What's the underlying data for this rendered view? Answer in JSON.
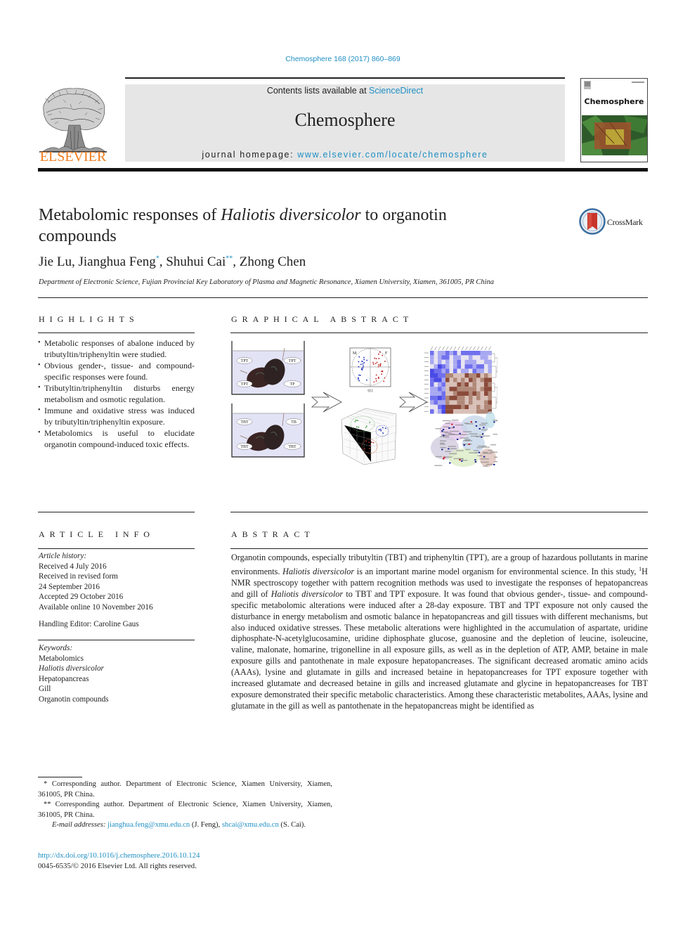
{
  "journal_citation": "Chemosphere 168 (2017) 860–869",
  "header": {
    "publisher_logo_word": "ELSEVIER",
    "contents_prefix": "Contents lists available at ",
    "contents_link": "ScienceDirect",
    "journal_name": "Chemosphere",
    "homepage_prefix": "journal homepage: ",
    "homepage_link": "www.elsevier.com/locate/chemosphere",
    "cover_title": "Chemosphere"
  },
  "article": {
    "title_part1": "Metabolomic responses of ",
    "title_italic": "Haliotis diversicolor",
    "title_part2": " to organotin",
    "title_line2": "compounds",
    "crossmark_label": "CrossMark",
    "authors": [
      {
        "name": "Jie Lu",
        "mark": ""
      },
      {
        "name": "Jianghua Feng",
        "mark": "*"
      },
      {
        "name": "Shuhui Cai",
        "mark": "**"
      },
      {
        "name": "Zhong Chen",
        "mark": ""
      }
    ],
    "affiliation": "Department of Electronic Science, Fujian Provincial Key Laboratory of Plasma and Magnetic Resonance, Xiamen University, Xiamen, 361005, PR China"
  },
  "highlights": {
    "heading": "HIGHLIGHTS",
    "items": [
      "Metabolic responses of abalone induced by tributyltin/triphenyltin were studied.",
      "Obvious gender-, tissue- and compound-specific responses were found.",
      "Tributyltin/triphenyltin disturbs energy metabolism and osmotic regulation.",
      "Immune and oxidative stress was induced by tributyltin/triphenyltin exposure.",
      "Metabolomics is useful to elucidate organotin compound-induced toxic effects."
    ]
  },
  "graphical_abstract": {
    "heading": "GRAPHICAL ABSTRACT",
    "tank_top_labels": [
      "TPT",
      "TPT",
      "TPT",
      "TP"
    ],
    "tank_bottom_labels": [
      "TBT",
      "TB",
      "TBT",
      "TBT"
    ],
    "pca_group_labels": [
      "M",
      "F"
    ],
    "pca_axis_label": "t[1]"
  },
  "article_info": {
    "heading": "ARTICLE INFO",
    "history_label": "Article history:",
    "history": [
      "Received 4 July 2016",
      "Received in revised form",
      "24 September 2016",
      "Accepted 29 October 2016",
      "Available online 10 November 2016"
    ],
    "handling_editor": "Handling Editor: Caroline Gaus",
    "keywords_label": "Keywords:",
    "keywords": [
      {
        "text": "Metabolomics",
        "italic": false
      },
      {
        "text": "Haliotis diversicolor",
        "italic": true
      },
      {
        "text": "Hepatopancreas",
        "italic": false
      },
      {
        "text": "Gill",
        "italic": false
      },
      {
        "text": "Organotin compounds",
        "italic": false
      }
    ]
  },
  "abstract": {
    "heading": "ABSTRACT",
    "p1": "Organotin compounds, especially tributyltin (TBT) and triphenyltin (TPT), are a group of hazardous pollutants in marine environments. ",
    "species": "Haliotis diversicolor",
    "p2": " is an important marine model organism for environmental science. In this study, ",
    "sup": "1",
    "p3": "H NMR spectroscopy together with pattern recognition methods was used to investigate the responses of hepatopancreas and gill of ",
    "p4": " to TBT and TPT exposure. It was found that obvious gender-, tissue- and compound-specific metabolomic alterations were induced after a 28-day exposure. TBT and TPT exposure not only caused the disturbance in energy metabolism and osmotic balance in hepatopancreas and gill tissues with different mechanisms, but also induced oxidative stresses. These metabolic alterations were highlighted in the accumulation of aspartate, uridine diphosphate-N-acetylglucosamine, uridine diphosphate glucose, guanosine and the depletion of leucine, isoleucine, valine, malonate, homarine, trigonelline in all exposure gills, as well as in the depletion of ATP, AMP, betaine in male exposure gills and pantothenate in male exposure hepatopancreases. The significant decreased aromatic amino acids (AAAs), lysine and glutamate in gills and increased betaine in hepatopancreases for TPT exposure together with increased glutamate and decreased betaine in gills and increased glutamate and glycine in hepatopancreases for TBT exposure demonstrated their specific metabolic characteristics. Among these characteristic metabolites, AAAs, lysine and glutamate in the gill as well as pantothenate in the hepatopancreas might be identified as"
  },
  "footnotes": {
    "fn1": "* Corresponding author. Department of Electronic Science, Xiamen University, Xiamen, 361005, PR China.",
    "fn2": "** Corresponding author. Department of Electronic Science, Xiamen University, Xiamen, 361005, PR China.",
    "email_label": "E-mail addresses:",
    "email1": "jianghua.feng@xmu.edu.cn",
    "email1_owner": " (J. Feng), ",
    "email2": "shcai@xmu.edu.cn",
    "email2_owner": " (S. Cai).",
    "doi": "http://dx.doi.org/10.1016/j.chemosphere.2016.10.124",
    "copyright": "0045-6535/© 2016 Elsevier Ltd. All rights reserved."
  },
  "colors": {
    "link": "#1f8fc4",
    "elsevier_orange": "#f07c1a",
    "banner_gray": "#e6e6e6"
  }
}
